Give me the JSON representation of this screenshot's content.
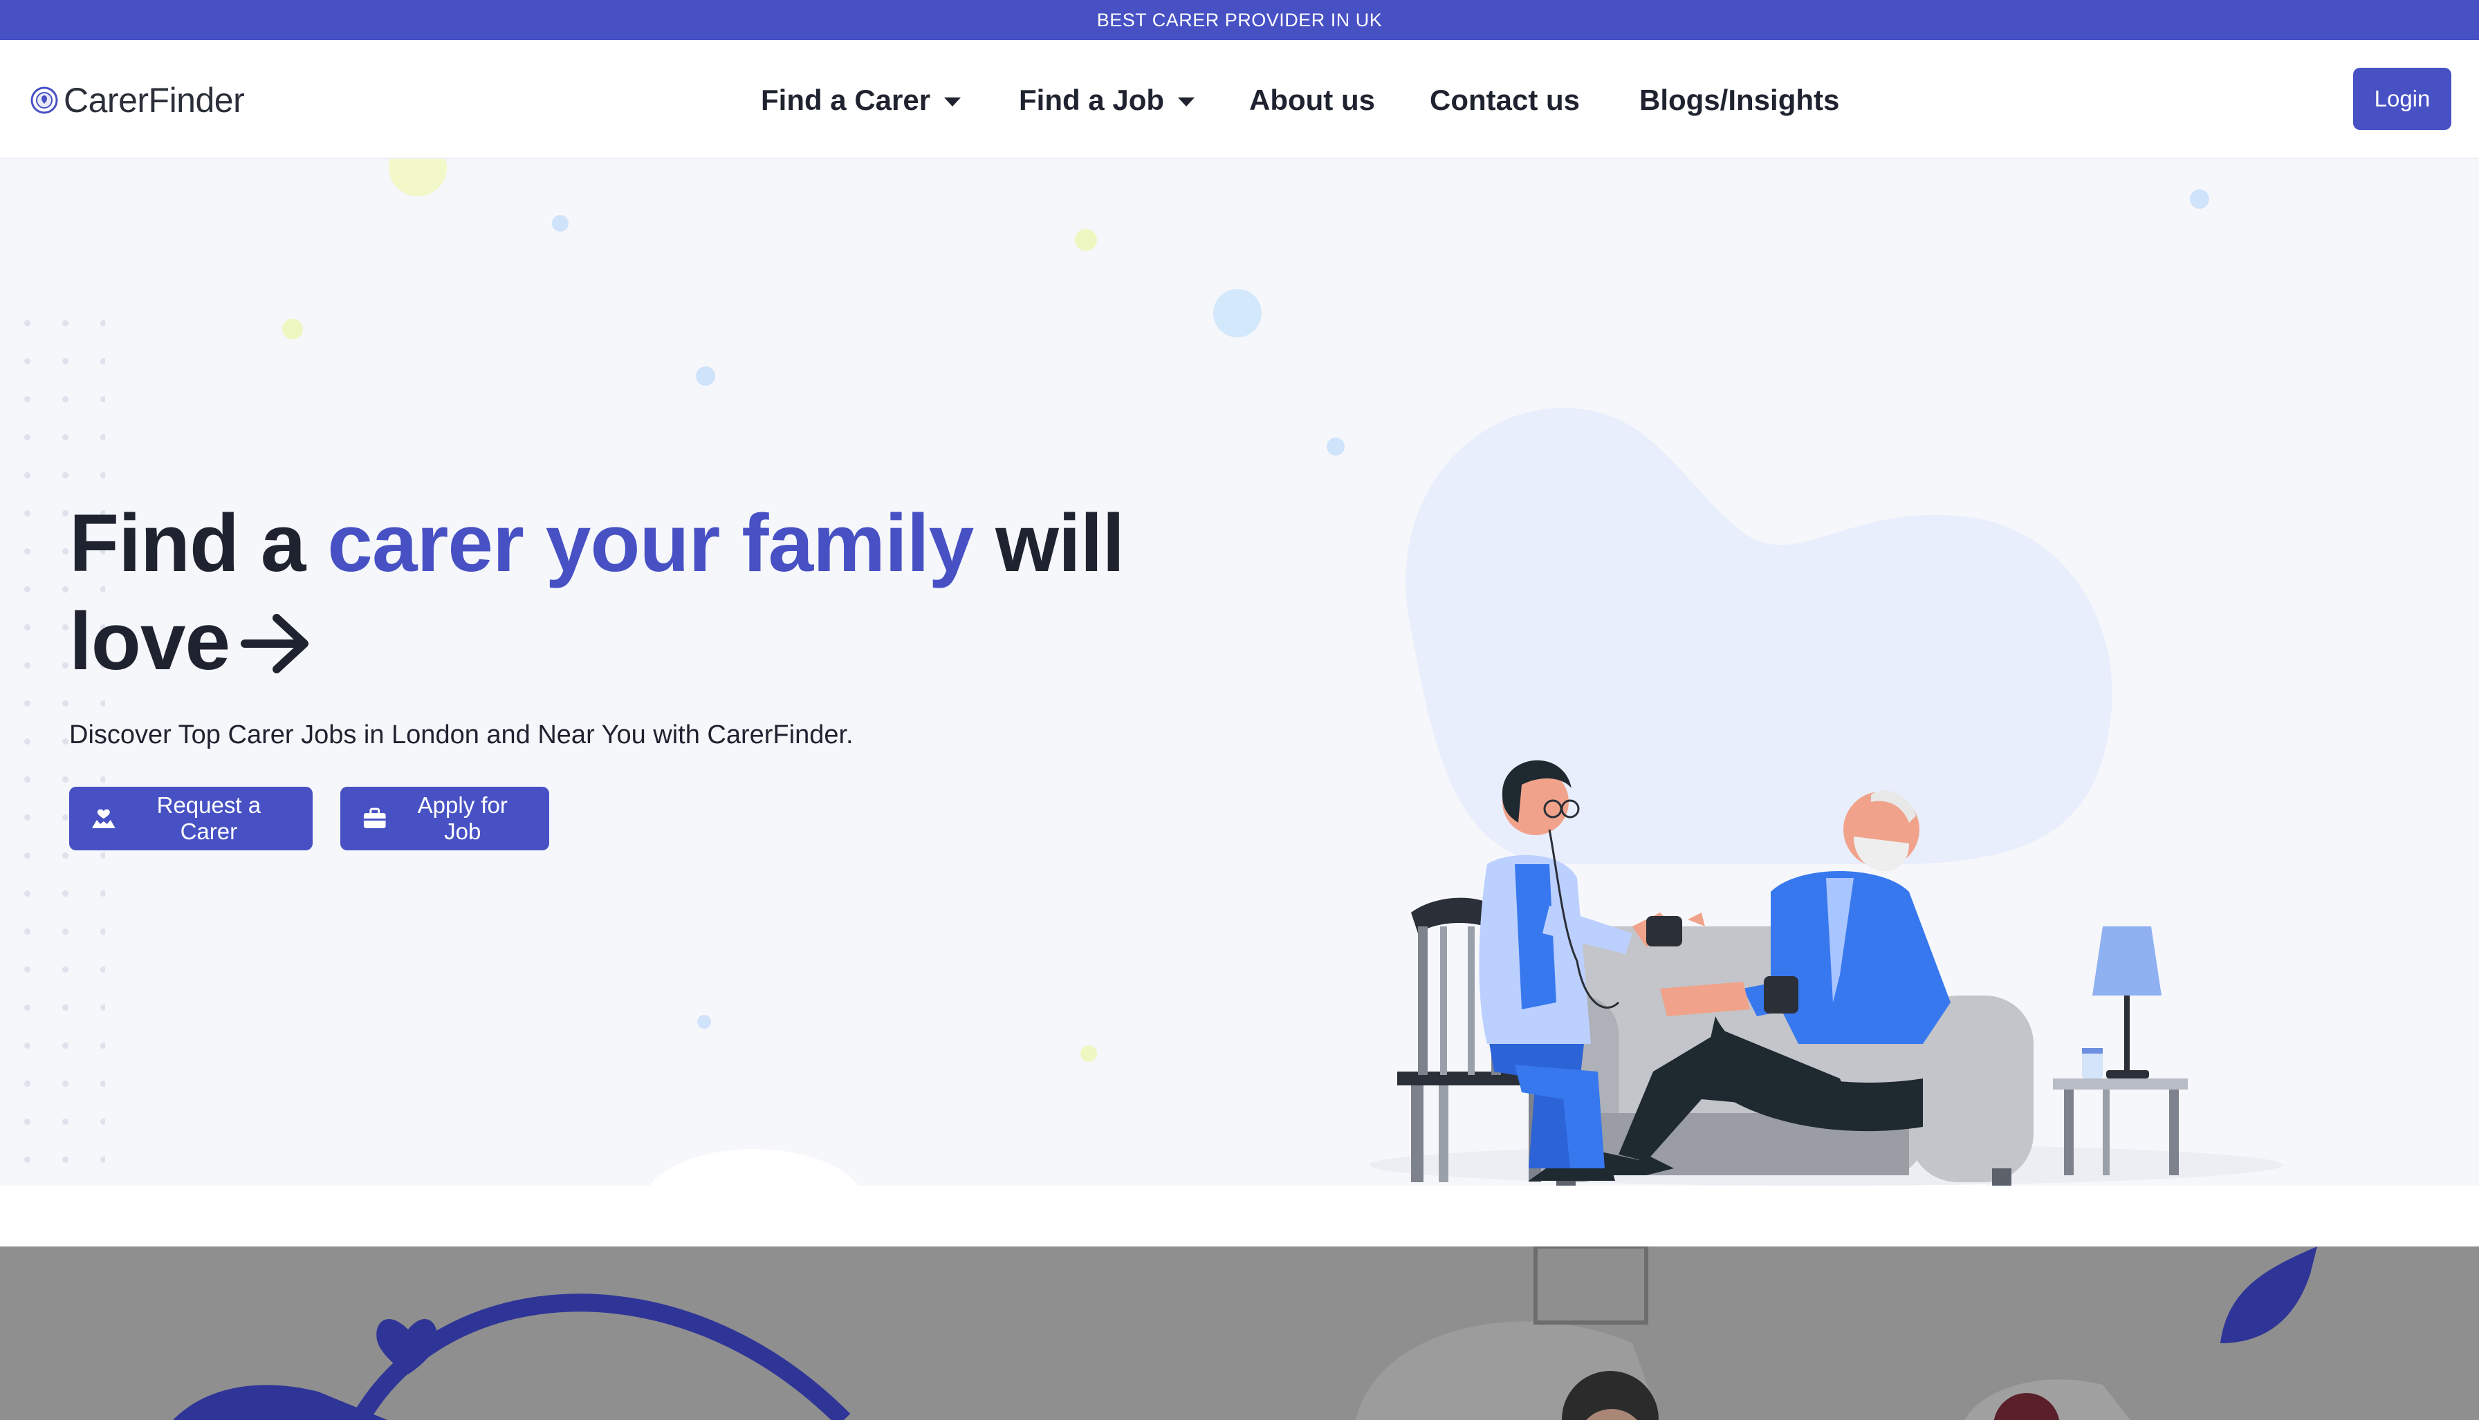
{
  "topbar": {
    "text": "BEST CARER PROVIDER IN UK"
  },
  "header": {
    "logo": {
      "brand": "CarerFinder",
      "icon": "carerfinder-logo-icon"
    },
    "nav": [
      {
        "label": "Find a Carer",
        "has_dropdown": true
      },
      {
        "label": "Find a Job",
        "has_dropdown": true
      },
      {
        "label": "About us",
        "has_dropdown": false
      },
      {
        "label": "Contact us",
        "has_dropdown": false
      },
      {
        "label": "Blogs/Insights",
        "has_dropdown": false
      }
    ],
    "login_label": "Login"
  },
  "hero": {
    "title_part1": "Find a",
    "title_accent": "carer your family",
    "title_part2": "will",
    "title_part3": "love",
    "title_icon": "arrow-right-icon",
    "subtitle": "Discover Top Carer Jobs in London and Near You with CarerFinder.",
    "buttons": [
      {
        "label": "Request a Carer",
        "icon": "hands-heart-icon"
      },
      {
        "label": "Apply for Job",
        "icon": "briefcase-icon"
      }
    ],
    "illustration": "carer-checking-elderly-man-blood-pressure"
  },
  "colors": {
    "brand": "#4751c4",
    "text": "#1f2330",
    "hero_bg": "#f6f7fb",
    "next_section_bg": "#8f8f8f"
  }
}
